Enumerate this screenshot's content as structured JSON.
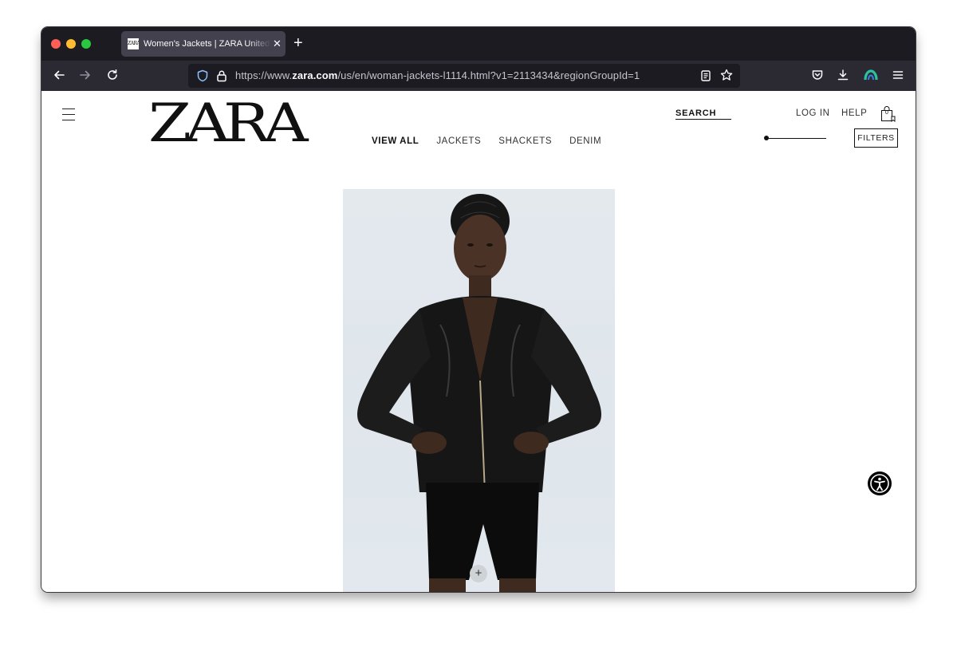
{
  "browser": {
    "tab": {
      "title": "Women's Jackets | ZARA United States",
      "favicon_text": "ZARA",
      "close_glyph": "✕"
    },
    "new_tab_glyph": "+",
    "url": {
      "prefix": "https://www.",
      "domain": "zara.com",
      "path": "/us/en/woman-jackets-l1114.html?v1=2113434&regionGroupId=1"
    },
    "icons": {
      "back": "arrow-left-icon",
      "forward": "arrow-right-icon",
      "reload": "reload-icon",
      "shield": "tracking-protection-shield-icon",
      "lock": "lock-icon",
      "reader": "reader-view-icon",
      "bookmark": "star-icon",
      "pocket": "pocket-icon",
      "download": "download-icon",
      "profile": "account-icon",
      "menu": "hamburger-menu-icon"
    },
    "colors": {
      "tabstrip": "#1c1b22",
      "navbar": "#2b2a33",
      "active_tab": "#42414d",
      "urlbar": "#1c1b22",
      "profile_accent": "#2ac3a2"
    }
  },
  "page": {
    "logo": "ZARA",
    "categories": [
      {
        "label": "VIEW ALL",
        "active": true
      },
      {
        "label": "JACKETS",
        "active": false
      },
      {
        "label": "SHACKETS",
        "active": false
      },
      {
        "label": "DENIM",
        "active": false
      }
    ],
    "search_label": "SEARCH",
    "login_label": "LOG IN",
    "help_label": "HELP",
    "bag_count": "0",
    "filters_label": "FILTERS",
    "product": {
      "image": "model-in-black-leather-jacket",
      "quick_add_glyph": "+"
    },
    "accessibility_icon": "accessibility-icon"
  }
}
